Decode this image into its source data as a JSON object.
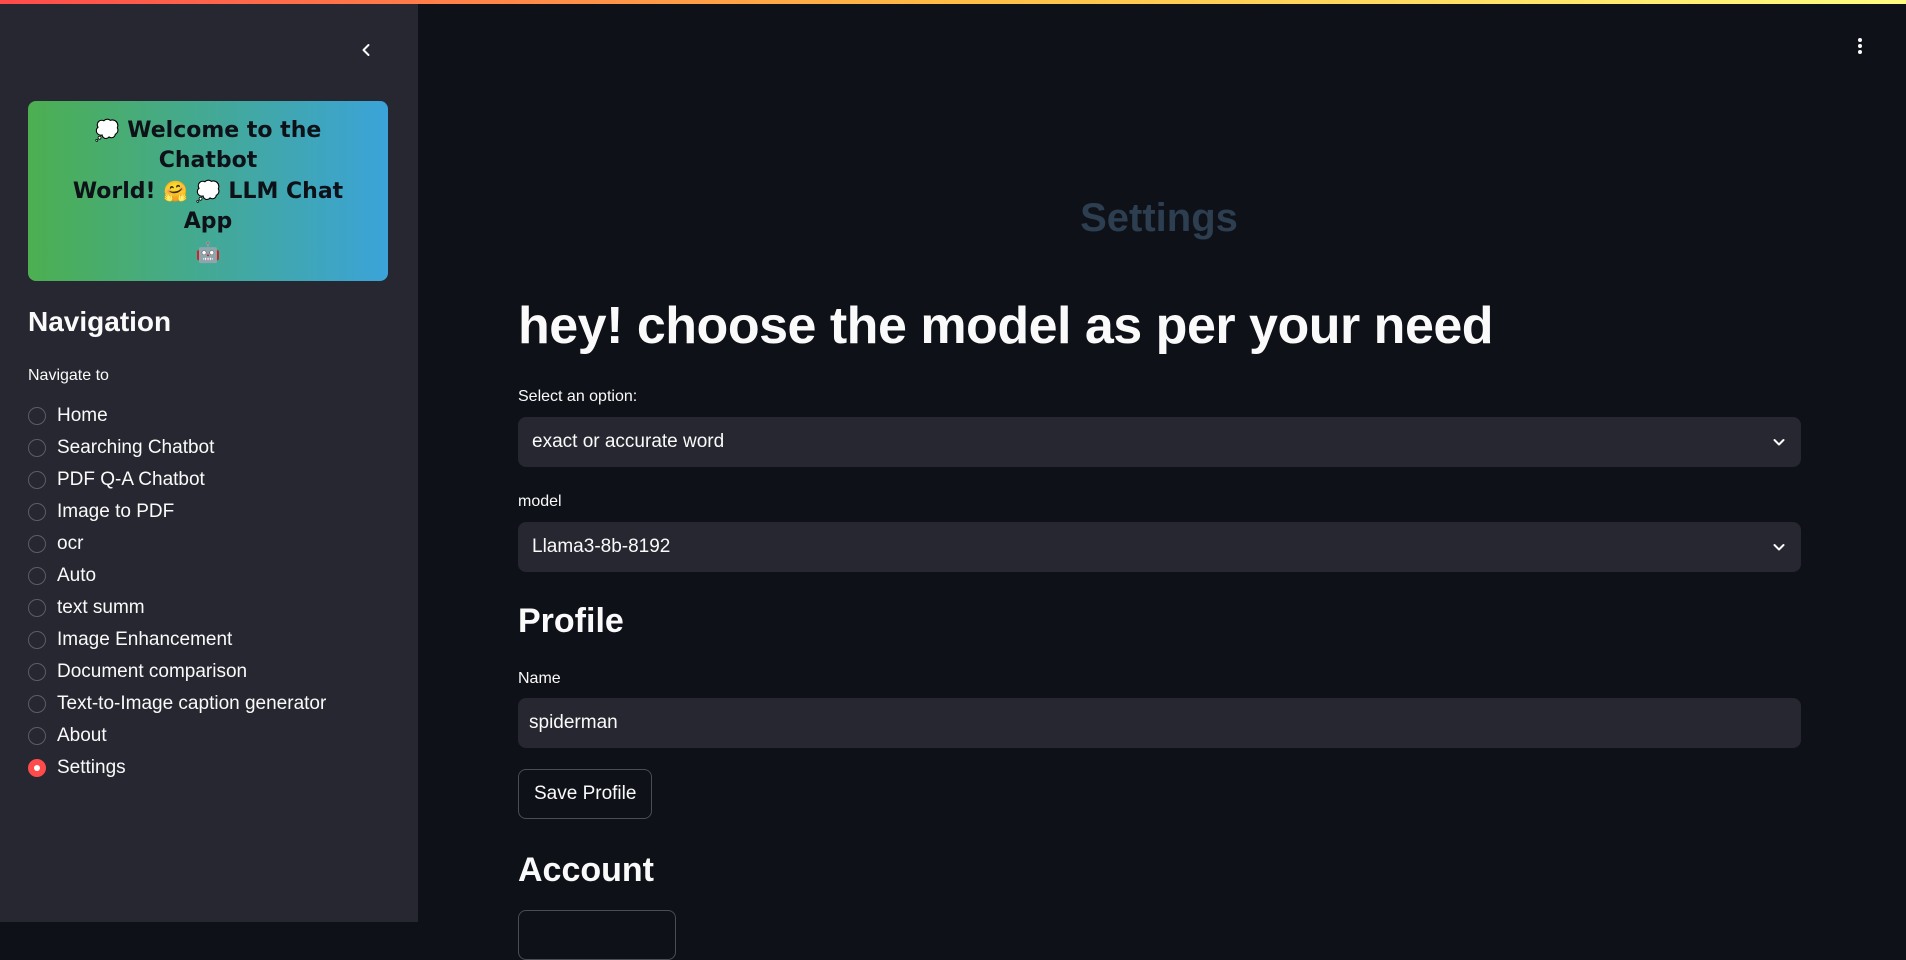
{
  "sidebar": {
    "welcome_line1": "Welcome to the Chatbot",
    "welcome_line2_a": "World!",
    "welcome_line2_b": "LLM Chat App",
    "welcome_emoji_speech": "💭",
    "welcome_emoji_hug": "🤗",
    "welcome_emoji_robot": "🤖",
    "nav_heading": "Navigation",
    "nav_caption": "Navigate to",
    "items": [
      {
        "label": "Home"
      },
      {
        "label": "Searching Chatbot"
      },
      {
        "label": "PDF Q-A Chatbot"
      },
      {
        "label": "Image to PDF"
      },
      {
        "label": "ocr"
      },
      {
        "label": "Auto"
      },
      {
        "label": "text summ"
      },
      {
        "label": "Image Enhancement"
      },
      {
        "label": "Document comparison"
      },
      {
        "label": "Text-to-Image caption generator"
      },
      {
        "label": "About"
      },
      {
        "label": "Settings"
      }
    ],
    "selected": "Settings"
  },
  "main": {
    "page_title": "Settings",
    "heading": "hey! choose the model as per your need",
    "option_select": {
      "label": "Select an option:",
      "value": "exact or accurate word"
    },
    "model_select": {
      "label": "model",
      "value": "Llama3-8b-8192"
    },
    "profile": {
      "heading": "Profile",
      "name_label": "Name",
      "name_value": "spiderman",
      "save_label": "Save Profile"
    },
    "account": {
      "heading": "Account"
    }
  },
  "colors": {
    "accent": "#ff4b4b",
    "background": "#0e1117",
    "sidebar_bg": "#262730",
    "input_bg": "#262730",
    "settings_title": "#2c3e50"
  },
  "icons": {
    "collapse": "chevron-left-icon",
    "menu": "more-vertical-icon",
    "dropdown": "chevron-down-icon"
  }
}
